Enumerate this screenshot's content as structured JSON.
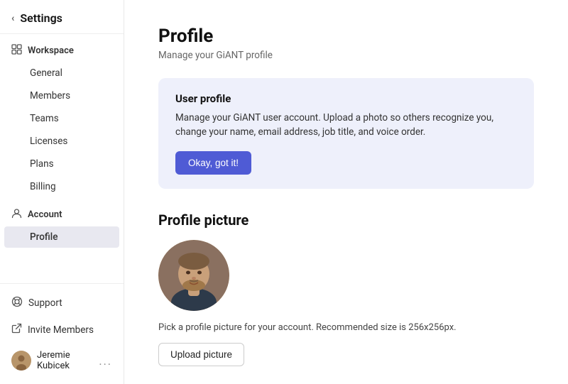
{
  "sidebar": {
    "header": {
      "back_icon": "‹",
      "title": "Settings"
    },
    "workspace": {
      "icon": "⊞",
      "label": "Workspace",
      "items": [
        {
          "id": "general",
          "label": "General"
        },
        {
          "id": "members",
          "label": "Members"
        },
        {
          "id": "teams",
          "label": "Teams"
        },
        {
          "id": "licenses",
          "label": "Licenses"
        },
        {
          "id": "plans",
          "label": "Plans"
        },
        {
          "id": "billing",
          "label": "Billing"
        }
      ]
    },
    "account": {
      "icon": "○",
      "label": "Account",
      "items": [
        {
          "id": "profile",
          "label": "Profile",
          "active": true
        }
      ]
    },
    "bottom": {
      "support": {
        "label": "Support",
        "icon": "?"
      },
      "invite": {
        "label": "Invite Members",
        "icon": "✈"
      }
    },
    "user": {
      "name": "Jeremie Kubicek",
      "more": "..."
    }
  },
  "main": {
    "title": "Profile",
    "subtitle": "Manage your GiANT profile",
    "banner": {
      "title": "User profile",
      "text": "Manage your GiANT user account. Upload a photo so others recognize you, change your name, email address, job title, and voice order.",
      "cta": "Okay, got it!"
    },
    "profile_picture": {
      "section_title": "Profile picture",
      "caption": "Pick a profile picture for your account. Recommended size is 256x256px.",
      "upload_btn": "Upload picture"
    }
  }
}
